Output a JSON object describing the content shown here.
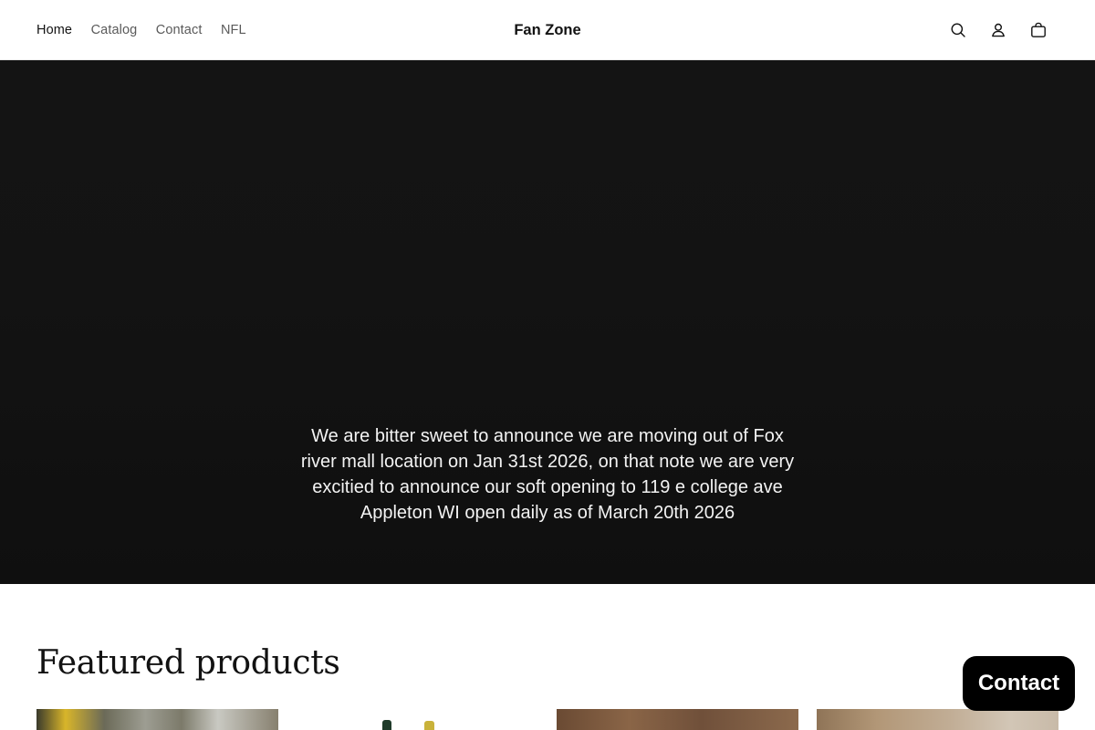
{
  "header": {
    "nav": [
      {
        "label": "Home",
        "active": true
      },
      {
        "label": "Catalog",
        "active": false
      },
      {
        "label": "Contact",
        "active": false
      },
      {
        "label": "NFL",
        "active": false
      }
    ],
    "brand": "Fan Zone",
    "icons": [
      "search-icon",
      "account-icon",
      "cart-icon"
    ]
  },
  "hero": {
    "message": "We are bitter sweet to announce we are moving out of Fox river mall location on Jan 31st 2026, on that note we are very excitied to announce our soft opening to 119 e college ave Appleton WI open daily as of March 20th 2026"
  },
  "featured": {
    "title": "Featured products"
  },
  "contact_fab": {
    "label": "Contact"
  },
  "colors": {
    "hero_bg": "#131313",
    "text": "#121212",
    "nav_muted": "#5a5a5a",
    "fab_bg": "#000000"
  }
}
